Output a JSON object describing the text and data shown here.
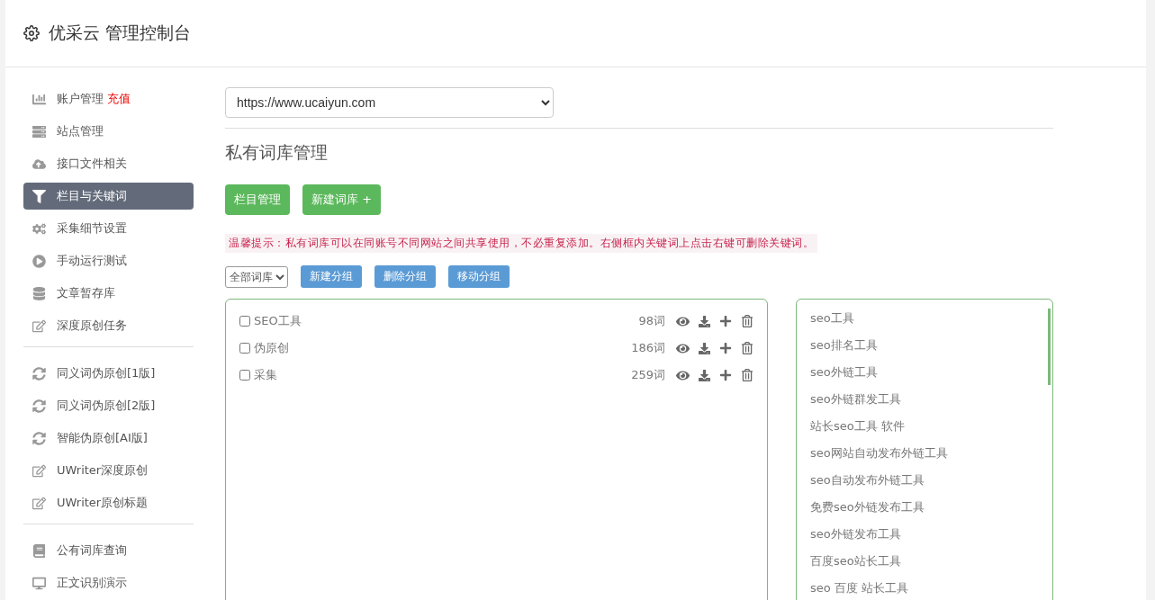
{
  "header": {
    "title": "优采云 管理控制台"
  },
  "sidebar": {
    "groups": [
      {
        "items": [
          {
            "label": "账户管理",
            "badge": "充值",
            "selected": false
          },
          {
            "label": "站点管理",
            "selected": false
          },
          {
            "label": "接口文件相关",
            "selected": false
          },
          {
            "label": "栏目与关键词",
            "selected": true
          },
          {
            "label": "采集细节设置",
            "selected": false
          },
          {
            "label": "手动运行测试",
            "selected": false
          },
          {
            "label": "文章暂存库",
            "selected": false
          },
          {
            "label": "深度原创任务",
            "selected": false
          }
        ]
      },
      {
        "items": [
          {
            "label": "同义词伪原创[1版]",
            "selected": false
          },
          {
            "label": "同义词伪原创[2版]",
            "selected": false
          },
          {
            "label": "智能伪原创[AI版]",
            "selected": false
          },
          {
            "label": "UWriter深度原创",
            "selected": false
          },
          {
            "label": "UWriter原创标题",
            "selected": false
          }
        ]
      },
      {
        "items": [
          {
            "label": "公有词库查询",
            "selected": false
          },
          {
            "label": "正文识别演示",
            "selected": false
          }
        ]
      }
    ]
  },
  "site_select": {
    "value": "https://www.ucaiyun.com"
  },
  "section_title": "私有词库管理",
  "primary_buttons": [
    "栏目管理",
    "新建词库 +"
  ],
  "tip": "温馨提示：私有词库可以在同账号不同网站之间共享使用，不必重复添加。右侧框内关键词上点击右键可删除关键词。",
  "group_filter": {
    "value": "全部词库"
  },
  "group_buttons": [
    "新建分组",
    "删除分组",
    "移动分组"
  ],
  "libraries": [
    {
      "name": "SEO工具",
      "count": "98词",
      "checked": false
    },
    {
      "name": "伪原创",
      "count": "186词",
      "checked": false
    },
    {
      "name": "采集",
      "count": "259词",
      "checked": false
    }
  ],
  "keywords": [
    "seo工具",
    "seo排名工具",
    "seo外链工具",
    "seo外链群发工具",
    "站长seo工具 软件",
    "seo网站自动发布外链工具",
    "seo自动发布外链工具",
    "免费seo外链发布工具",
    "seo外链发布工具",
    "百度seo站长工具",
    "seo 百度 站长工具"
  ]
}
